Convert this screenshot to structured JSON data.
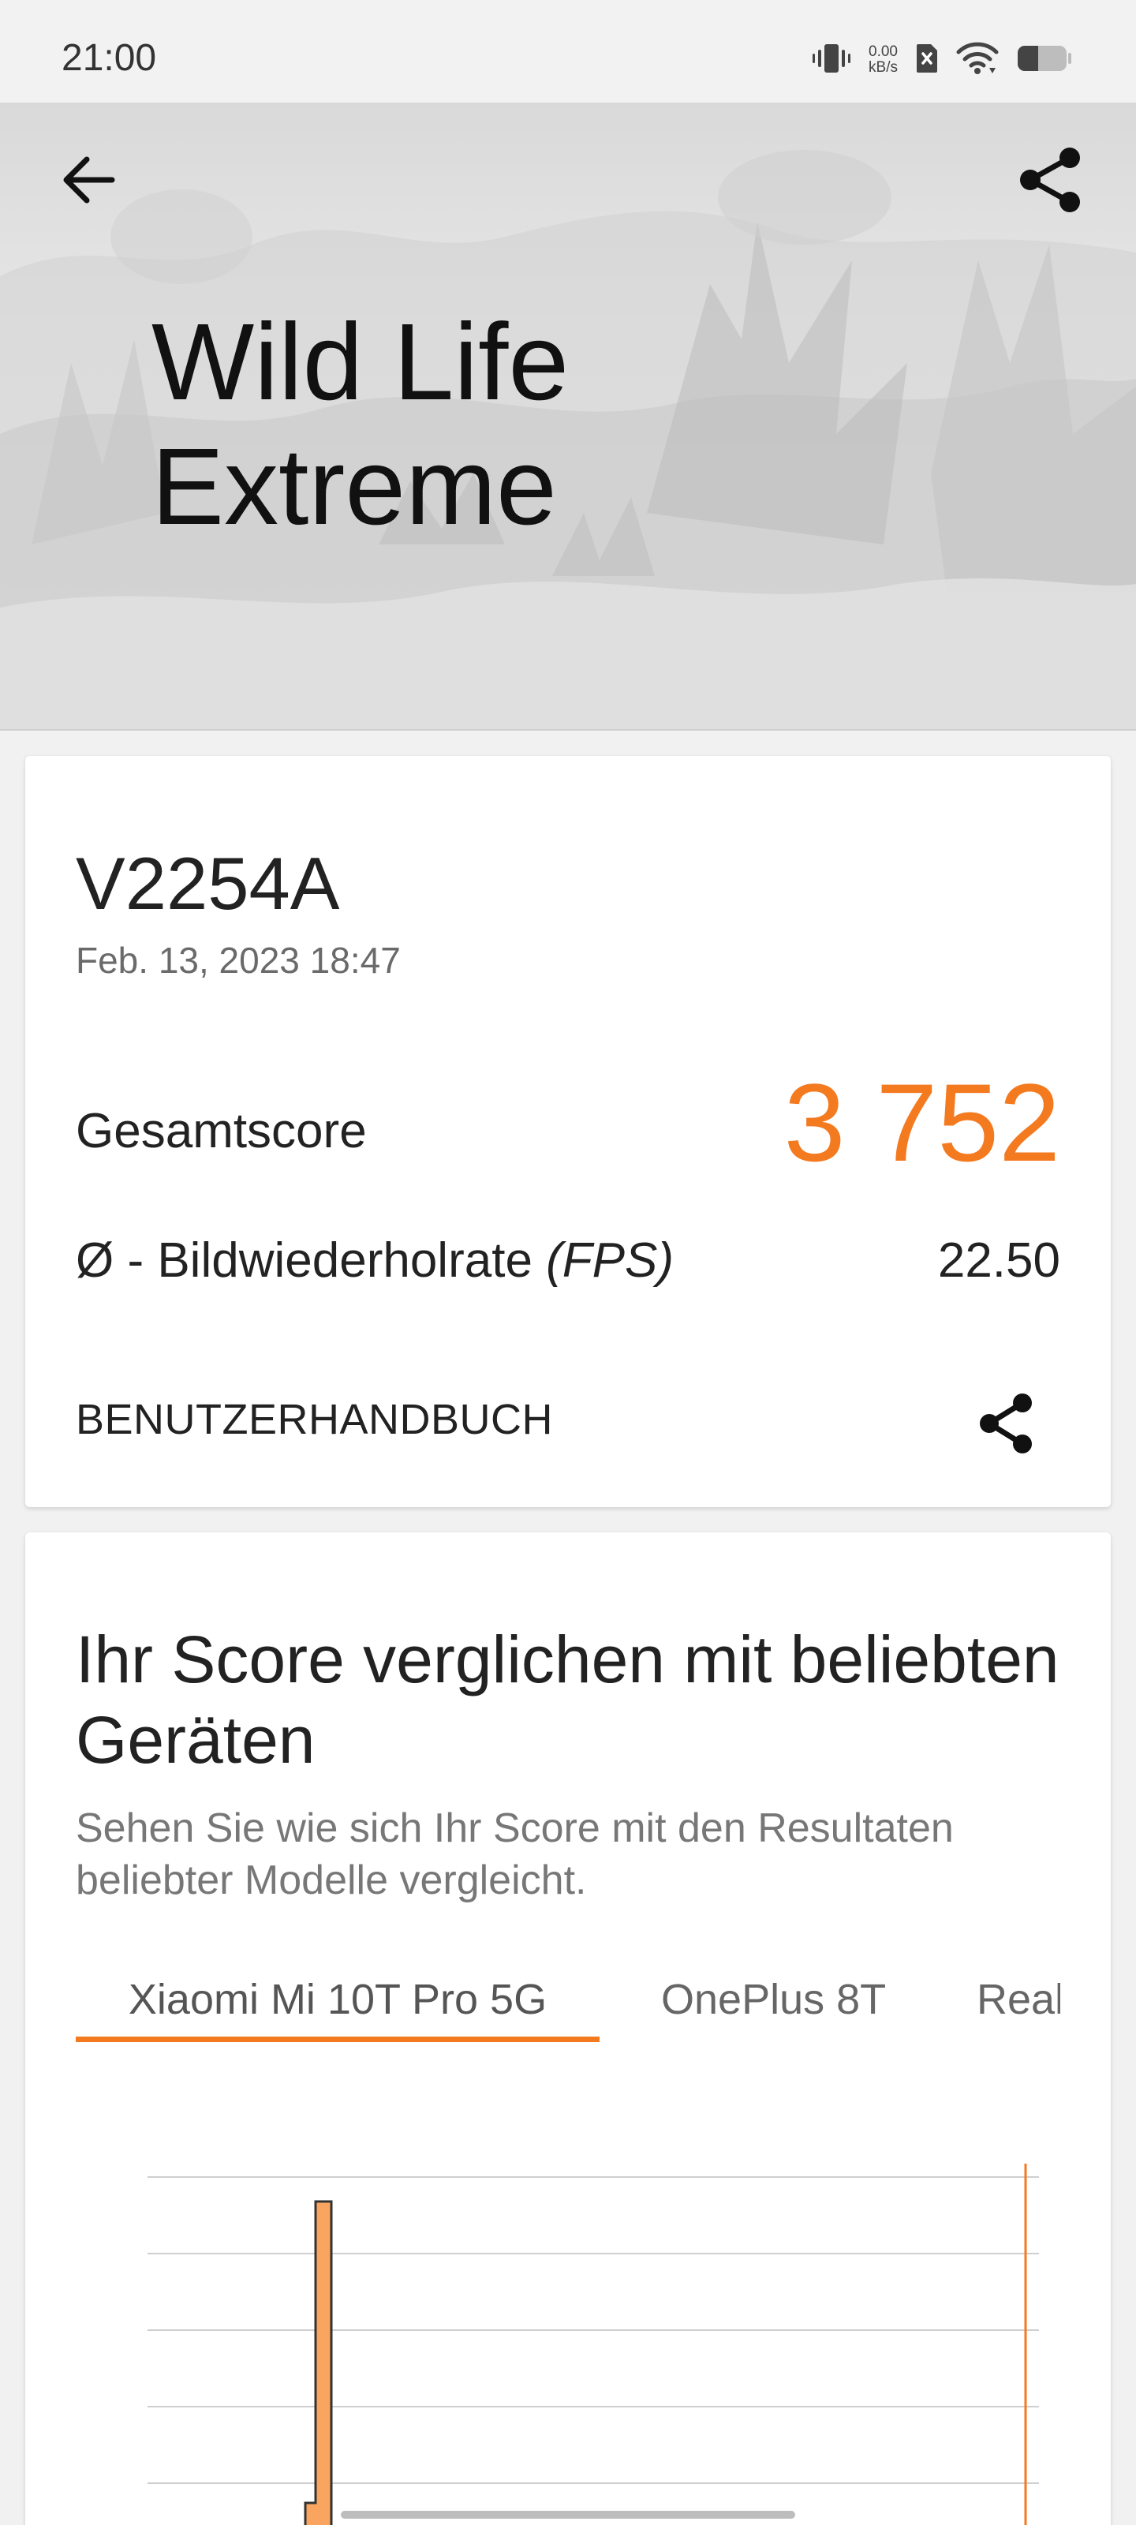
{
  "status": {
    "time": "21:00",
    "net_speed_value": "0.00",
    "net_speed_unit": "kB/s"
  },
  "hero": {
    "title_line1": "Wild Life",
    "title_line2": "Extreme"
  },
  "result": {
    "device": "V2254A",
    "date": "Feb. 13, 2023 18:47",
    "score_label": "Gesamtscore",
    "score_value": "3 752",
    "fps_label_prefix": "Ø - Bildwiederholrate",
    "fps_label_unit": "(FPS)",
    "fps_value": "22.50",
    "manual_label": "BENUTZERHANDBUCH"
  },
  "compare": {
    "title": "Ihr Score verglichen mit beliebten Geräten",
    "description": "Sehen Sie wie sich Ihr Score mit den Resultaten beliebter Modelle vergleicht.",
    "tabs": [
      "Xiaomi Mi 10T Pro 5G",
      "OnePlus 8T",
      "Realr"
    ],
    "active_tab": 0
  },
  "colors": {
    "accent": "#f47a20",
    "bar": "#f9a55f",
    "text_dark": "#222222",
    "text_muted": "#777777"
  },
  "icons": [
    "back-arrow-icon",
    "share-icon",
    "vibrate-icon",
    "no-sim-icon",
    "wifi-icon",
    "battery-icon"
  ]
}
